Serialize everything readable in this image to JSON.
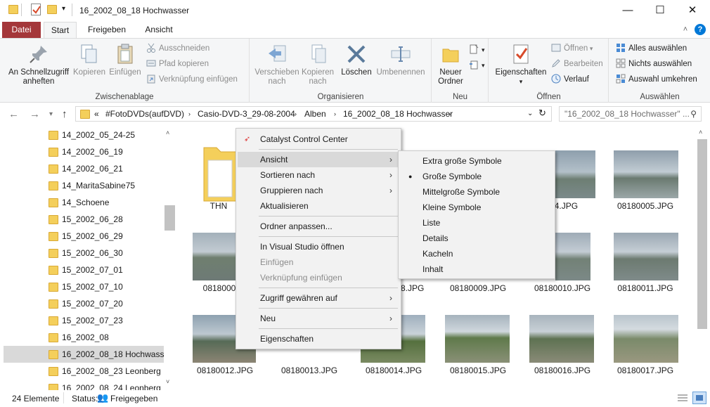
{
  "window": {
    "title": "16_2002_08_18 Hochwasser",
    "minimize_glyph": "—",
    "maximize_glyph": "☐",
    "close_glyph": "✕"
  },
  "tabs": [
    {
      "label": "Datei"
    },
    {
      "label": "Start"
    },
    {
      "label": "Freigeben"
    },
    {
      "label": "Ansicht"
    }
  ],
  "ribbon": {
    "clipboard": {
      "label": "Zwischenablage",
      "pin": "An Schnellzugriff\nanheften",
      "copy": "Kopieren",
      "paste": "Einfügen",
      "cut": "Ausschneiden",
      "copy_path": "Pfad kopieren",
      "paste_shortcut": "Verknüpfung einfügen"
    },
    "organize": {
      "label": "Organisieren",
      "move_to": "Verschieben\nnach",
      "copy_to": "Kopieren\nnach",
      "delete": "Löschen",
      "rename": "Umbenennen"
    },
    "new": {
      "label": "Neu",
      "new_folder": "Neuer\nOrdner"
    },
    "open": {
      "label": "Öffnen",
      "properties": "Eigenschaften",
      "open": "Öffnen",
      "edit": "Bearbeiten",
      "history": "Verlauf"
    },
    "select": {
      "label": "Auswählen",
      "select_all": "Alles auswählen",
      "select_none": "Nichts auswählen",
      "invert": "Auswahl umkehren"
    }
  },
  "address": {
    "crumbs": [
      "«",
      "#FotoDVDs(aufDVD)",
      "Casio-DVD-3_29-08-2004",
      "Alben",
      "16_2002_08_18 Hochwasser"
    ],
    "search_placeholder": "\"16_2002_08_18 Hochwasser\" ..."
  },
  "tree": {
    "items": [
      {
        "label": "14_2002_05_24-25"
      },
      {
        "label": "14_2002_06_19"
      },
      {
        "label": "14_2002_06_21"
      },
      {
        "label": "14_MaritaSabine75"
      },
      {
        "label": "14_Schoene"
      },
      {
        "label": "15_2002_06_28"
      },
      {
        "label": "15_2002_06_29"
      },
      {
        "label": "15_2002_06_30"
      },
      {
        "label": "15_2002_07_01"
      },
      {
        "label": "15_2002_07_10"
      },
      {
        "label": "15_2002_07_20"
      },
      {
        "label": "15_2002_07_23"
      },
      {
        "label": "16_2002_08"
      },
      {
        "label": "16_2002_08_18 Hochwasser"
      },
      {
        "label": "16_2002_08_23 Leonberg"
      },
      {
        "label": "16_2002_08_24 Leonberg"
      }
    ]
  },
  "files": {
    "row1": [
      "THN",
      "08180004.JPG",
      "08180005.JPG"
    ],
    "row2": [
      "0818000",
      "8.JPG",
      "08180009.JPG",
      "08180010.JPG",
      "08180011.JPG"
    ],
    "row3": [
      "08180012.JPG",
      "08180013.JPG",
      "08180014.JPG",
      "08180015.JPG",
      "08180016.JPG",
      "08180017.JPG"
    ]
  },
  "context_menu": {
    "items": [
      {
        "label": "Catalyst Control Center"
      },
      {
        "label": "Ansicht"
      },
      {
        "label": "Sortieren nach"
      },
      {
        "label": "Gruppieren nach"
      },
      {
        "label": "Aktualisieren"
      },
      {
        "label": "Ordner anpassen..."
      },
      {
        "label": "In Visual Studio öffnen"
      },
      {
        "label": "Einfügen"
      },
      {
        "label": "Verknüpfung einfügen"
      },
      {
        "label": "Zugriff gewähren auf"
      },
      {
        "label": "Neu"
      },
      {
        "label": "Eigenschaften"
      }
    ]
  },
  "view_submenu": {
    "items": [
      {
        "label": "Extra große Symbole"
      },
      {
        "label": "Große Symbole"
      },
      {
        "label": "Mittelgroße Symbole"
      },
      {
        "label": "Kleine Symbole"
      },
      {
        "label": "Liste"
      },
      {
        "label": "Details"
      },
      {
        "label": "Kacheln"
      },
      {
        "label": "Inhalt"
      }
    ]
  },
  "status": {
    "count": "24 Elemente",
    "state_label": "Status:",
    "state_value": "Freigegeben"
  },
  "colors": {
    "datei_tab": "#a4373a",
    "accent": "#0078d7",
    "folder": "#f4cf5b"
  }
}
